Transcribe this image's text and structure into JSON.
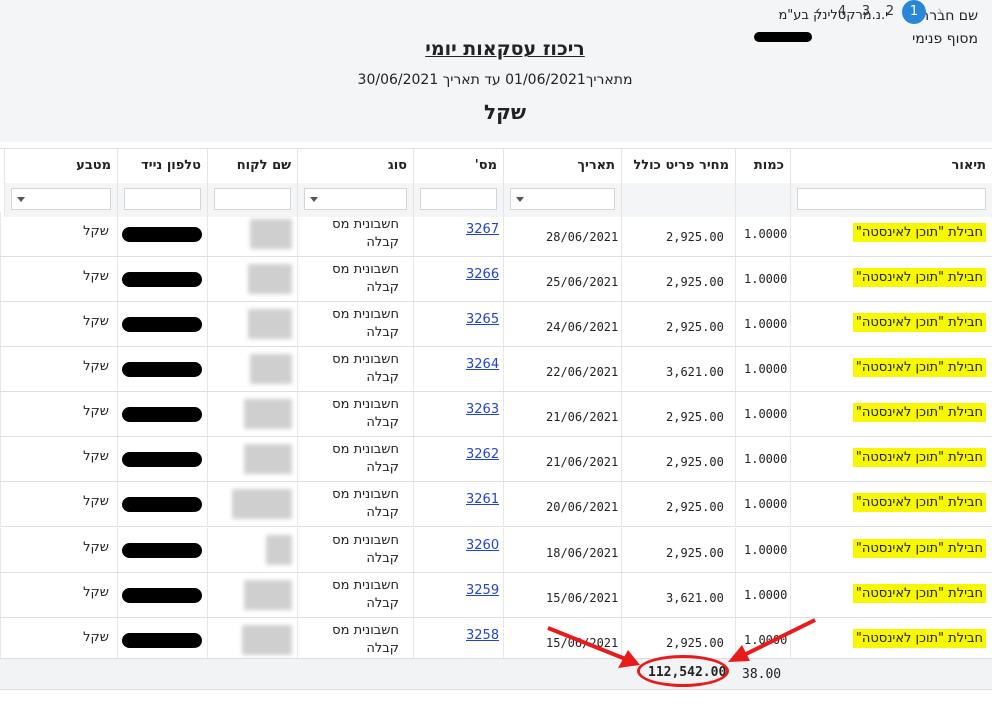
{
  "header": {
    "company_label": "שם חברה",
    "company_name": "י.נ.מרקטלינק בע\"מ",
    "branch_label": "מסוף פנימי",
    "title": "ריכוז עסקאות יומי",
    "date_range": "מתאריך01/06/2021 עד תאריך 30/06/2021",
    "currency": "שקל"
  },
  "columns": {
    "description": "תיאור",
    "quantity": "כמות",
    "price": "מחיר פריט כולל",
    "date": "תאריך",
    "number": "מס'",
    "type": "סוג",
    "customer": "שם לקוח",
    "phone": "טלפון נייד",
    "currency": "מטבע"
  },
  "rows": [
    {
      "description": "חבילת \"תוכן לאינסטה\"",
      "quantity": "1.0000",
      "price": "2,925.00",
      "date": "28/06/2021",
      "number": "3267",
      "type_line1": "חשבונית מס",
      "type_line2": "קבלה",
      "currency": "שקל"
    },
    {
      "description": "חבילת \"תוכן לאינסטה\"",
      "quantity": "1.0000",
      "price": "2,925.00",
      "date": "25/06/2021",
      "number": "3266",
      "type_line1": "חשבונית מס",
      "type_line2": "קבלה",
      "currency": "שקל"
    },
    {
      "description": "חבילת \"תוכן לאינסטה\"",
      "quantity": "1.0000",
      "price": "2,925.00",
      "date": "24/06/2021",
      "number": "3265",
      "type_line1": "חשבונית מס",
      "type_line2": "קבלה",
      "currency": "שקל"
    },
    {
      "description": "חבילת \"תוכן לאינסטה\"",
      "quantity": "1.0000",
      "price": "3,621.00",
      "date": "22/06/2021",
      "number": "3264",
      "type_line1": "חשבונית מס",
      "type_line2": "קבלה",
      "currency": "שקל"
    },
    {
      "description": "חבילת \"תוכן לאינסטה\"",
      "quantity": "1.0000",
      "price": "2,925.00",
      "date": "21/06/2021",
      "number": "3263",
      "type_line1": "חשבונית מס",
      "type_line2": "קבלה",
      "currency": "שקל"
    },
    {
      "description": "חבילת \"תוכן לאינסטה\"",
      "quantity": "1.0000",
      "price": "2,925.00",
      "date": "21/06/2021",
      "number": "3262",
      "type_line1": "חשבונית מס",
      "type_line2": "קבלה",
      "currency": "שקל"
    },
    {
      "description": "חבילת \"תוכן לאינסטה\"",
      "quantity": "1.0000",
      "price": "2,925.00",
      "date": "20/06/2021",
      "number": "3261",
      "type_line1": "חשבונית מס",
      "type_line2": "קבלה",
      "currency": "שקל"
    },
    {
      "description": "חבילת \"תוכן לאינסטה\"",
      "quantity": "1.0000",
      "price": "2,925.00",
      "date": "18/06/2021",
      "number": "3260",
      "type_line1": "חשבונית מס",
      "type_line2": "קבלה",
      "currency": "שקל"
    },
    {
      "description": "חבילת \"תוכן לאינסטה\"",
      "quantity": "1.0000",
      "price": "3,621.00",
      "date": "15/06/2021",
      "number": "3259",
      "type_line1": "חשבונית מס",
      "type_line2": "קבלה",
      "currency": "שקל"
    },
    {
      "description": "חבילת \"תוכן לאינסטה\"",
      "quantity": "1.0000",
      "price": "2,925.00",
      "date": "15/06/2021",
      "number": "3258",
      "type_line1": "חשבונית מס",
      "type_line2": "קבלה",
      "currency": "שקל"
    }
  ],
  "totals": {
    "quantity": "38.00",
    "amount": "112,542.00"
  },
  "pagination": {
    "pages": [
      "4",
      "3",
      "2",
      "1"
    ],
    "current": "1",
    "prev_symbol": "‹",
    "next_symbol": "›"
  },
  "colors": {
    "highlight": "#f7f700",
    "annotation": "#e81b1b",
    "active_page": "#2a86d6",
    "link": "#2244cc"
  }
}
